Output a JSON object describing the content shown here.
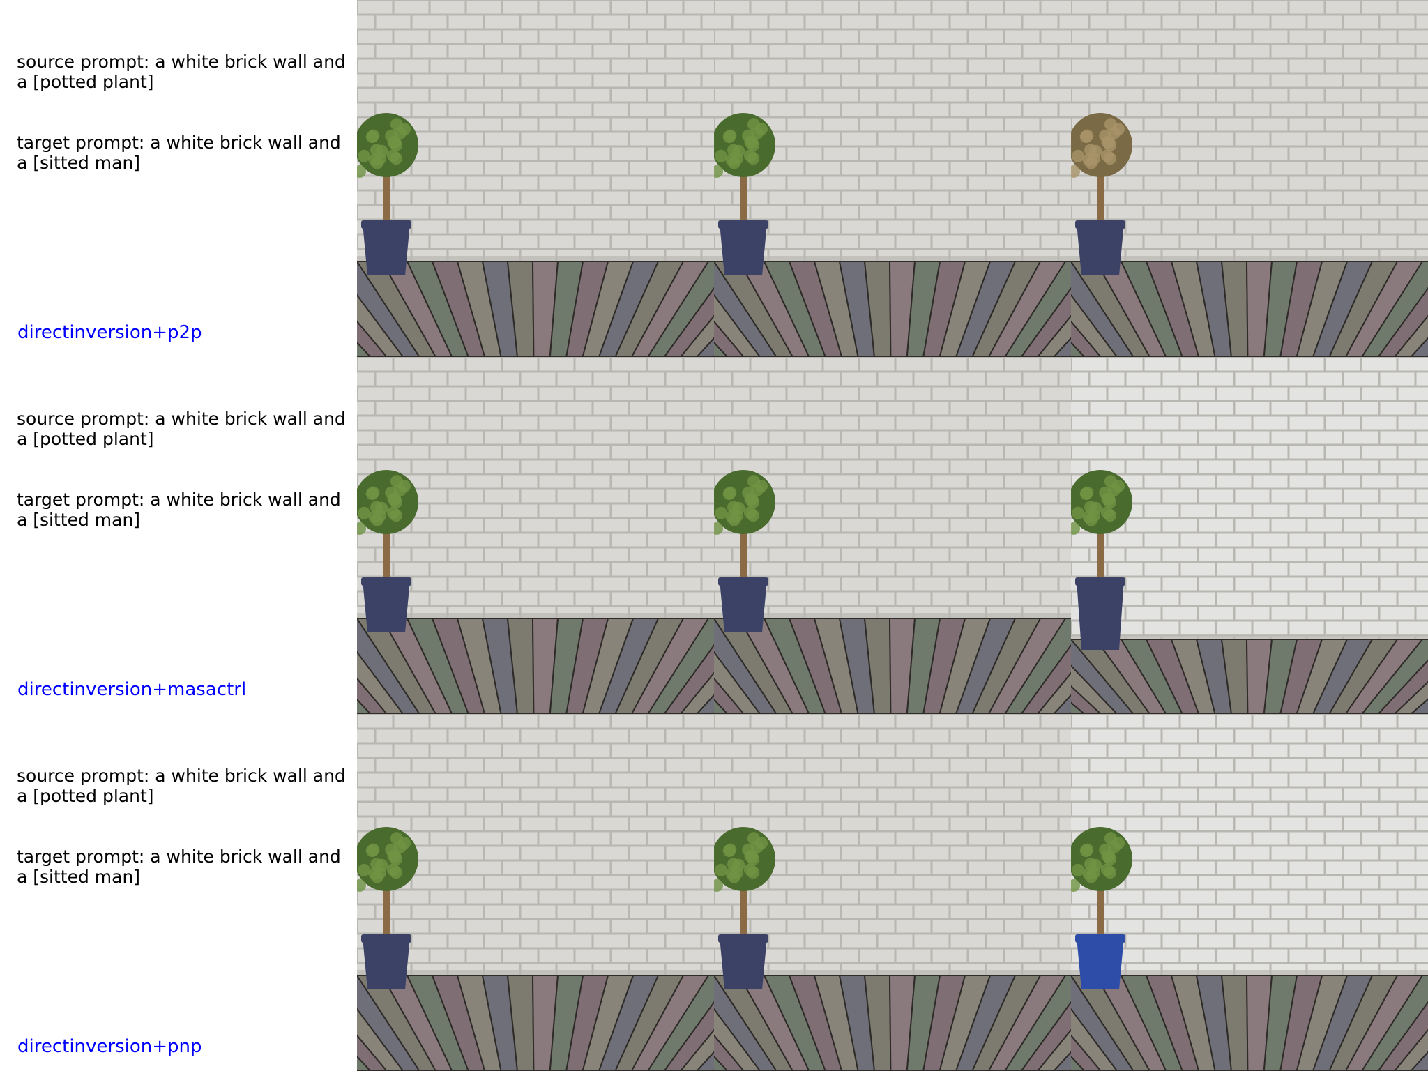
{
  "rows": [
    {
      "source_prompt": "source prompt: a white brick wall and a [potted plant]",
      "target_prompt": "target prompt: a white brick wall and a [sitted man]",
      "method": "directinversion+p2p"
    },
    {
      "source_prompt": "source prompt: a white brick wall and a [potted plant]",
      "target_prompt": "target prompt: a white brick wall and a [sitted man]",
      "method": "directinversion+masactrl"
    },
    {
      "source_prompt": "source prompt: a white brick wall and a [potted plant]",
      "target_prompt": "target prompt: a white brick wall and a [sitted man]",
      "method": "directinversion+pnp"
    }
  ],
  "colors": {
    "method_label": "#0000ff",
    "prompt_text": "#000000",
    "wall": "#d9d8d4",
    "mortar": "#b8b7b2",
    "floor_planks": [
      "#7d7a6f",
      "#8a7a7e",
      "#6f7a6c",
      "#7f6f75",
      "#88847a",
      "#6e6f78"
    ],
    "foliage": "#4a6b2e",
    "foliage_dry": "#7a6a45",
    "pot_navy": "#3b4266",
    "pot_blue": "#2d4da8"
  }
}
